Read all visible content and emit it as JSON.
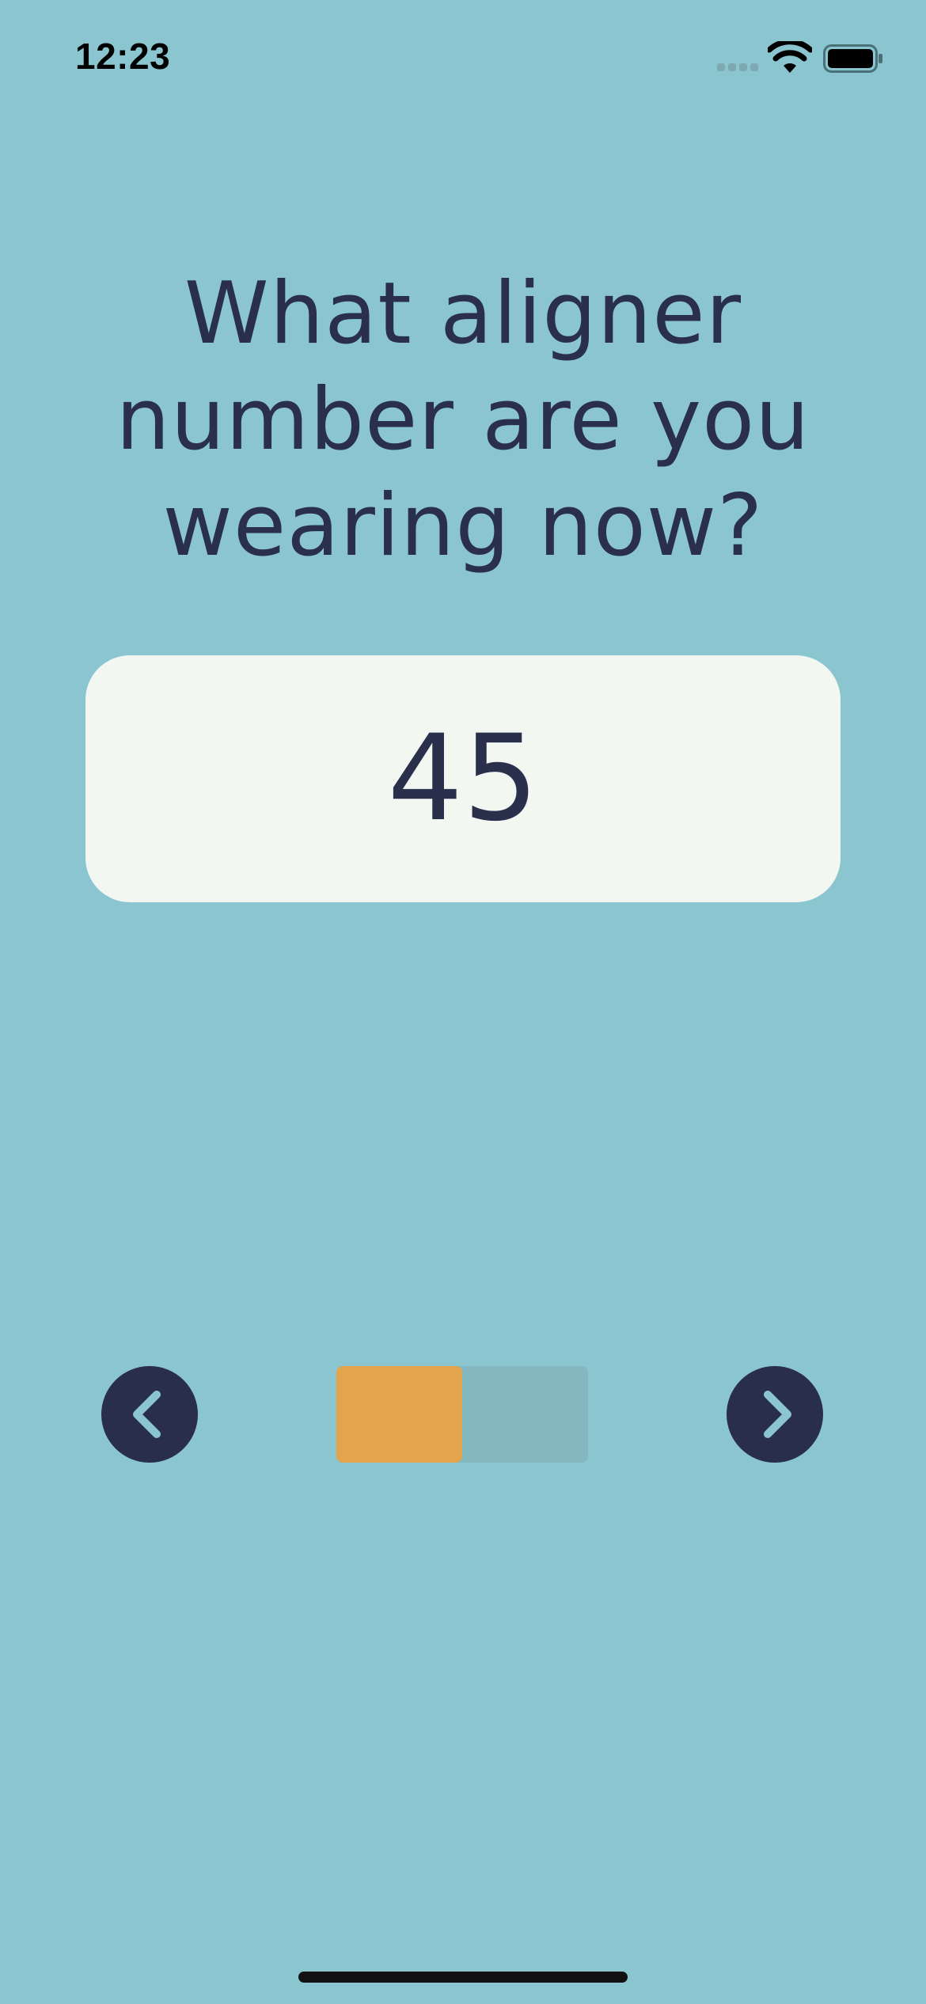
{
  "status_bar": {
    "time": "12:23",
    "icons": [
      "cellular-signal-icon",
      "wifi-icon",
      "battery-icon"
    ]
  },
  "question": {
    "text": "What aligner number are you wearing now?"
  },
  "aligner_input": {
    "value": "45"
  },
  "navigation": {
    "prev_icon": "chevron-left-icon",
    "next_icon": "chevron-right-icon"
  },
  "progress": {
    "fraction": 0.5
  },
  "colors": {
    "background": "#8BC6D0",
    "text": "#2A2F4C",
    "card": "#F2F7F2",
    "button": "#292E4B",
    "chevron": "#8BC6D0",
    "progress_fill": "#E3A54B",
    "progress_track": "#84B8C0"
  }
}
